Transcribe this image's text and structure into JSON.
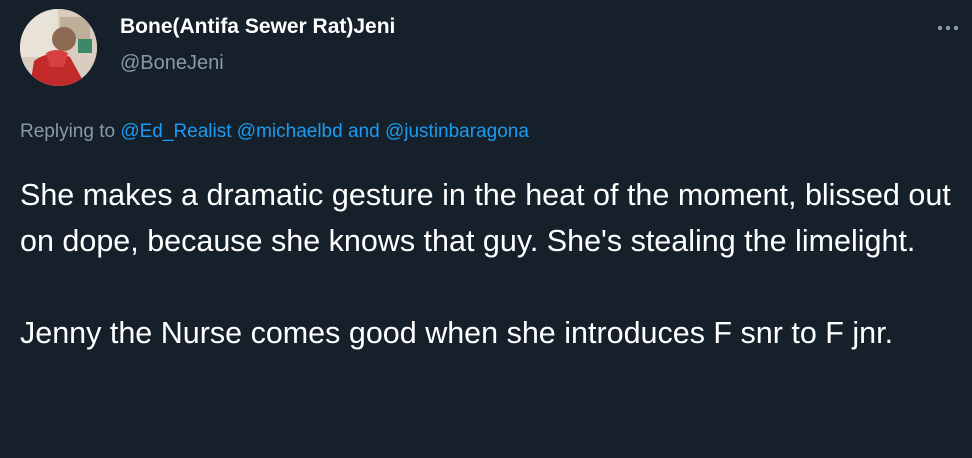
{
  "tweet": {
    "display_name": "Bone(Antifa Sewer Rat)Jeni",
    "handle": "@BoneJeni",
    "more_icon": "more-horizontal-icon",
    "replying_to": {
      "prefix": "Replying to",
      "mention1": "@Ed_Realist",
      "mention2": "@michaelbd",
      "conjunction": "and",
      "mention3": "@justinbaragona"
    },
    "paragraphs": [
      "She makes a dramatic gesture in the heat of the moment, blissed out on dope, because she knows that guy. She's stealing the limelight.",
      "Jenny the Nurse comes good when she introduces F snr to F jnr."
    ]
  },
  "colors": {
    "background": "#15202b",
    "text": "#ffffff",
    "secondary": "#8b98a5",
    "accent": "#1d9bf0"
  }
}
